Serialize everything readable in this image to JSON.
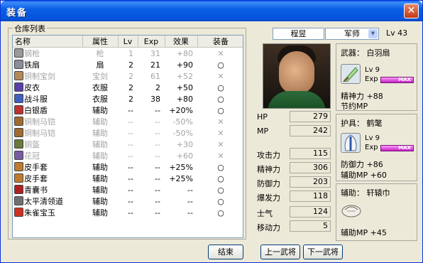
{
  "window": {
    "title": "装备",
    "close_glyph": "✕"
  },
  "inventory": {
    "group_label": "仓库列表",
    "columns": [
      "名称",
      "属性",
      "Lv",
      "Exp",
      "效果",
      "装备"
    ],
    "rows": [
      {
        "name": "钢枪",
        "attr": "枪",
        "lv": "1",
        "exp": "31",
        "effect": "+80",
        "equip": "✕",
        "dim": true,
        "icon": "spear-icon",
        "color": "#9A9A9A"
      },
      {
        "name": "铁扇",
        "attr": "扇",
        "lv": "2",
        "exp": "21",
        "effect": "+90",
        "equip": "○",
        "dim": false,
        "icon": "fan-icon",
        "color": "#8A8E96"
      },
      {
        "name": "铜制宝剑",
        "attr": "宝剑",
        "lv": "2",
        "exp": "61",
        "effect": "+52",
        "equip": "✕",
        "dim": true,
        "icon": "sword-icon",
        "color": "#B58A5A"
      },
      {
        "name": "皮衣",
        "attr": "衣服",
        "lv": "2",
        "exp": "2",
        "effect": "+50",
        "equip": "○",
        "dim": false,
        "icon": "leather-coat-icon",
        "color": "#5A3FA8"
      },
      {
        "name": "战斗服",
        "attr": "衣服",
        "lv": "2",
        "exp": "38",
        "effect": "+80",
        "equip": "○",
        "dim": false,
        "icon": "battle-suit-icon",
        "color": "#4060C0"
      },
      {
        "name": "白银盾",
        "attr": "辅助",
        "lv": "--",
        "exp": "--",
        "effect": "+20%",
        "equip": "○",
        "dim": false,
        "icon": "silver-shield-icon",
        "color": "#C03030"
      },
      {
        "name": "铜制马铠",
        "attr": "辅助",
        "lv": "--",
        "exp": "--",
        "effect": "-50%",
        "equip": "✕",
        "dim": true,
        "icon": "horse-armor-icon",
        "color": "#A06A30"
      },
      {
        "name": "铜制马铠",
        "attr": "辅助",
        "lv": "--",
        "exp": "--",
        "effect": "-50%",
        "equip": "✕",
        "dim": true,
        "icon": "horse-armor-icon",
        "color": "#A06A30"
      },
      {
        "name": "铜盔",
        "attr": "辅助",
        "lv": "--",
        "exp": "--",
        "effect": "+30",
        "equip": "✕",
        "dim": true,
        "icon": "bronze-helmet-icon",
        "color": "#6A7A3A"
      },
      {
        "name": "花冠",
        "attr": "辅助",
        "lv": "--",
        "exp": "--",
        "effect": "+60",
        "equip": "✕",
        "dim": true,
        "icon": "flower-crown-icon",
        "color": "#7A5AA0"
      },
      {
        "name": "皮手套",
        "attr": "辅助",
        "lv": "--",
        "exp": "--",
        "effect": "+25%",
        "equip": "○",
        "dim": false,
        "icon": "glove-icon",
        "color": "#C07A30"
      },
      {
        "name": "皮手套",
        "attr": "辅助",
        "lv": "--",
        "exp": "--",
        "effect": "+25%",
        "equip": "○",
        "dim": false,
        "icon": "glove-icon",
        "color": "#C07A30"
      },
      {
        "name": "青囊书",
        "attr": "辅助",
        "lv": "--",
        "exp": "--",
        "effect": "--",
        "equip": "○",
        "dim": false,
        "icon": "medical-book-icon",
        "color": "#B02020"
      },
      {
        "name": "太平清领道",
        "attr": "辅助",
        "lv": "--",
        "exp": "--",
        "effect": "--",
        "equip": "○",
        "dim": false,
        "icon": "scroll-book-icon",
        "color": "#707070"
      },
      {
        "name": "朱雀宝玉",
        "attr": "辅助",
        "lv": "--",
        "exp": "--",
        "effect": "--",
        "equip": "○",
        "dim": false,
        "icon": "red-jade-icon",
        "color": "#D03020"
      }
    ]
  },
  "buttons": {
    "close": "结束",
    "prev": "上一武将",
    "next": "下一武将"
  },
  "general": {
    "name": "程昱",
    "role": "军师",
    "level": "Lv 43",
    "stats": [
      {
        "label": "HP",
        "value": "279"
      },
      {
        "label": "MP",
        "value": "242"
      },
      {
        "label": "攻击力",
        "value": "115"
      },
      {
        "label": "精神力",
        "value": "306"
      },
      {
        "label": "防御力",
        "value": "203"
      },
      {
        "label": "爆发力",
        "value": "118"
      },
      {
        "label": "士气",
        "value": "124"
      },
      {
        "label": "移动力",
        "value": "5"
      }
    ]
  },
  "equipment": {
    "weapon": {
      "title": "武器： 白羽扇",
      "lv": "Lv  9",
      "exp_label": "Exp",
      "exp_text": "MAX",
      "line1": "精神力  +88",
      "line2": "节约MP"
    },
    "armor": {
      "title": "护具： 鹤氅",
      "lv": "Lv  9",
      "exp_label": "Exp",
      "exp_text": "MAX",
      "line1": "防御力  +86",
      "line2": "辅助MP  +60"
    },
    "accessory": {
      "title": "辅助： 轩辕巾",
      "line1": "辅助MP  +45"
    }
  },
  "colors": {
    "title_blue": "#0553DB",
    "exp_bar": "#E040E0"
  }
}
